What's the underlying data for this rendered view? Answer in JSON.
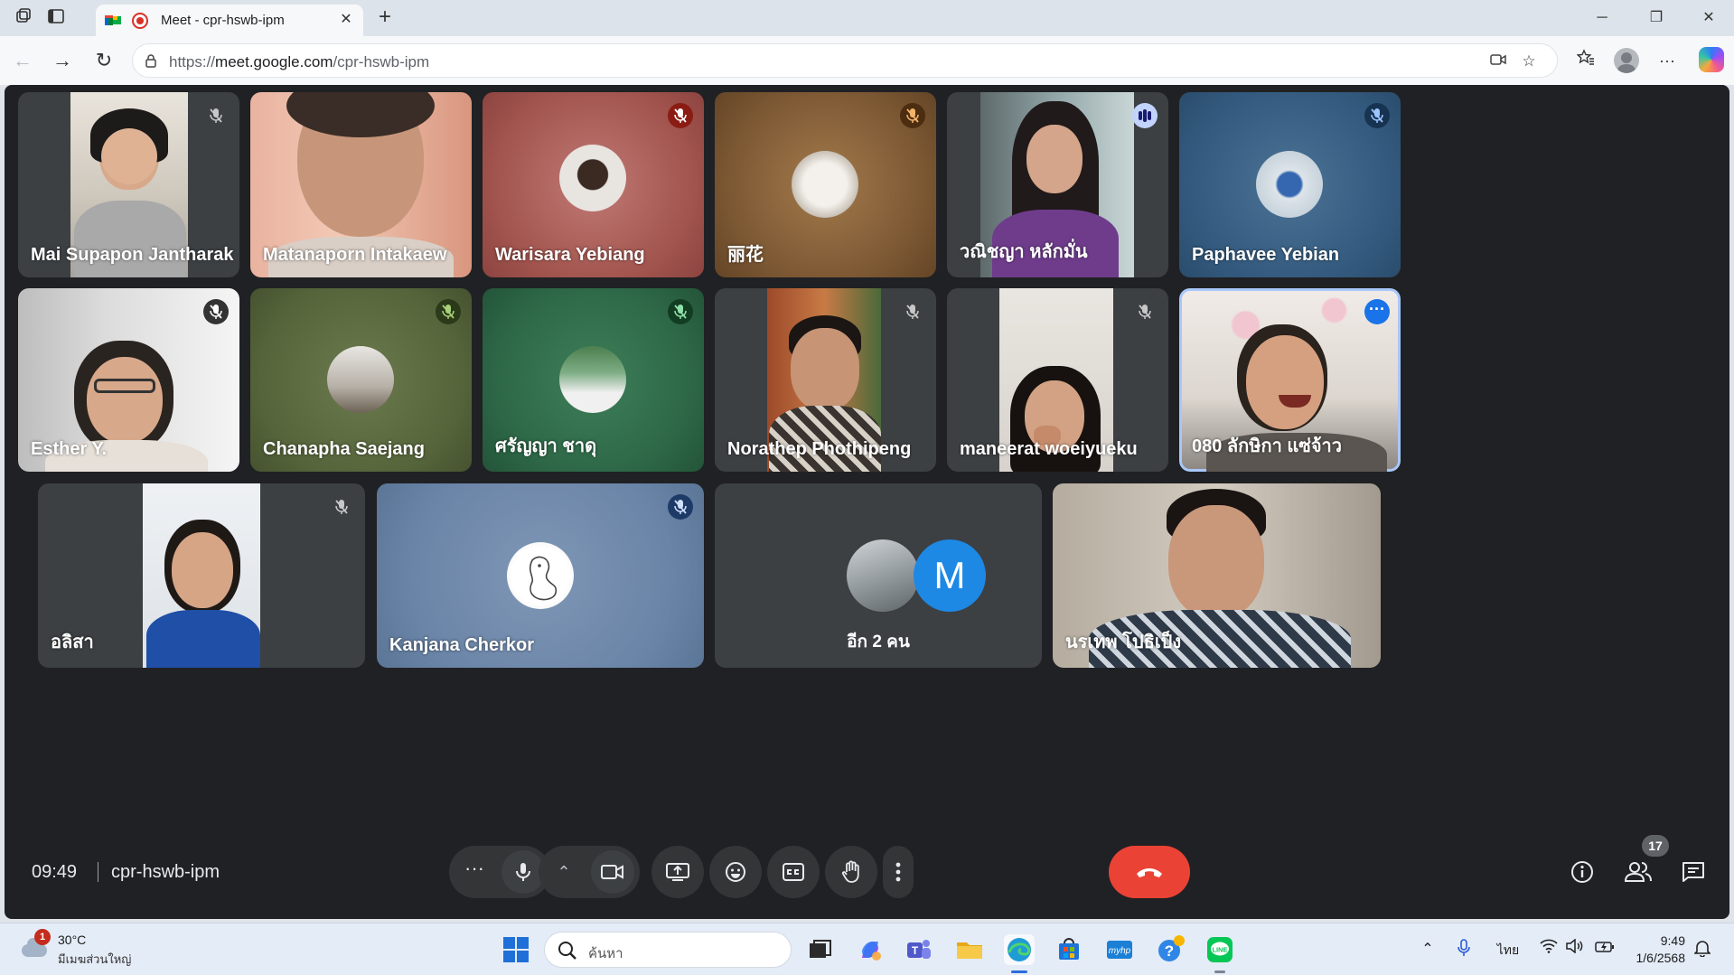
{
  "browser": {
    "tab_title": "Meet - cpr-hswb-ipm",
    "url_prefix": "https://",
    "url_host": "meet.google.com",
    "url_path": "/cpr-hswb-ipm",
    "icons": [
      "workspaces-icon",
      "vertical-tabs-icon",
      "meet-favicon",
      "recording-icon",
      "close-tab-icon",
      "new-tab-icon",
      "minimize-icon",
      "maximize-icon",
      "close-window-icon",
      "back-icon",
      "forward-icon",
      "refresh-icon",
      "lock-icon",
      "camera-permission-icon",
      "star-icon",
      "favorites-icon",
      "profile-icon",
      "more-icon",
      "copilot-icon"
    ]
  },
  "meeting": {
    "time": "09:49",
    "code": "cpr-hswb-ipm",
    "participant_count": "17",
    "tiles": [
      {
        "name": "Mai Supapon Jantharak",
        "status": "muted"
      },
      {
        "name": "Matanaporn Intakaew",
        "status": "none"
      },
      {
        "name": "Warisara Yebiang",
        "status": "muted"
      },
      {
        "name": "丽花",
        "status": "muted"
      },
      {
        "name": "วณิชญา หลักมั่น",
        "status": "speaking"
      },
      {
        "name": "Paphavee Yebian",
        "status": "muted"
      },
      {
        "name": "Esther Y.",
        "status": "muted"
      },
      {
        "name": "Chanapha Saejang",
        "status": "muted"
      },
      {
        "name": "ศรัญญา ชาดุ",
        "status": "muted"
      },
      {
        "name": "Norathep Phothipeng",
        "status": "muted"
      },
      {
        "name": "maneerat woeiyueku",
        "status": "muted"
      },
      {
        "name": "080 ลักษิกา แซ่จ้าว",
        "status": "more-options"
      },
      {
        "name": "อลิสา",
        "status": "muted"
      },
      {
        "name": "Kanjana Cherkor",
        "status": "muted"
      },
      {
        "name": "นรเทพ โปธิเป็ง",
        "status": "none"
      }
    ],
    "overflow": {
      "label": "อีก 2 คน",
      "initial": "M"
    },
    "controls": [
      "more-reactions",
      "microphone",
      "camera-options",
      "camera",
      "present-screen",
      "emoji-reactions",
      "captions",
      "raise-hand",
      "more-options",
      "leave-call"
    ],
    "right_controls": [
      "meeting-details",
      "people",
      "chat"
    ]
  },
  "taskbar": {
    "weather_temp": "30°C",
    "weather_desc": "มีเมฆส่วนใหญ่",
    "weather_badge": "1",
    "search_placeholder": "ค้นหา",
    "language": "ไทย",
    "clock_time": "9:49",
    "clock_date": "1/6/2568"
  },
  "colors": {
    "meet_bg": "#202124",
    "tile_bg": "#3c4043",
    "control_bg": "#333537",
    "end_call": "#ea4335",
    "accent": "#1a73e8"
  }
}
